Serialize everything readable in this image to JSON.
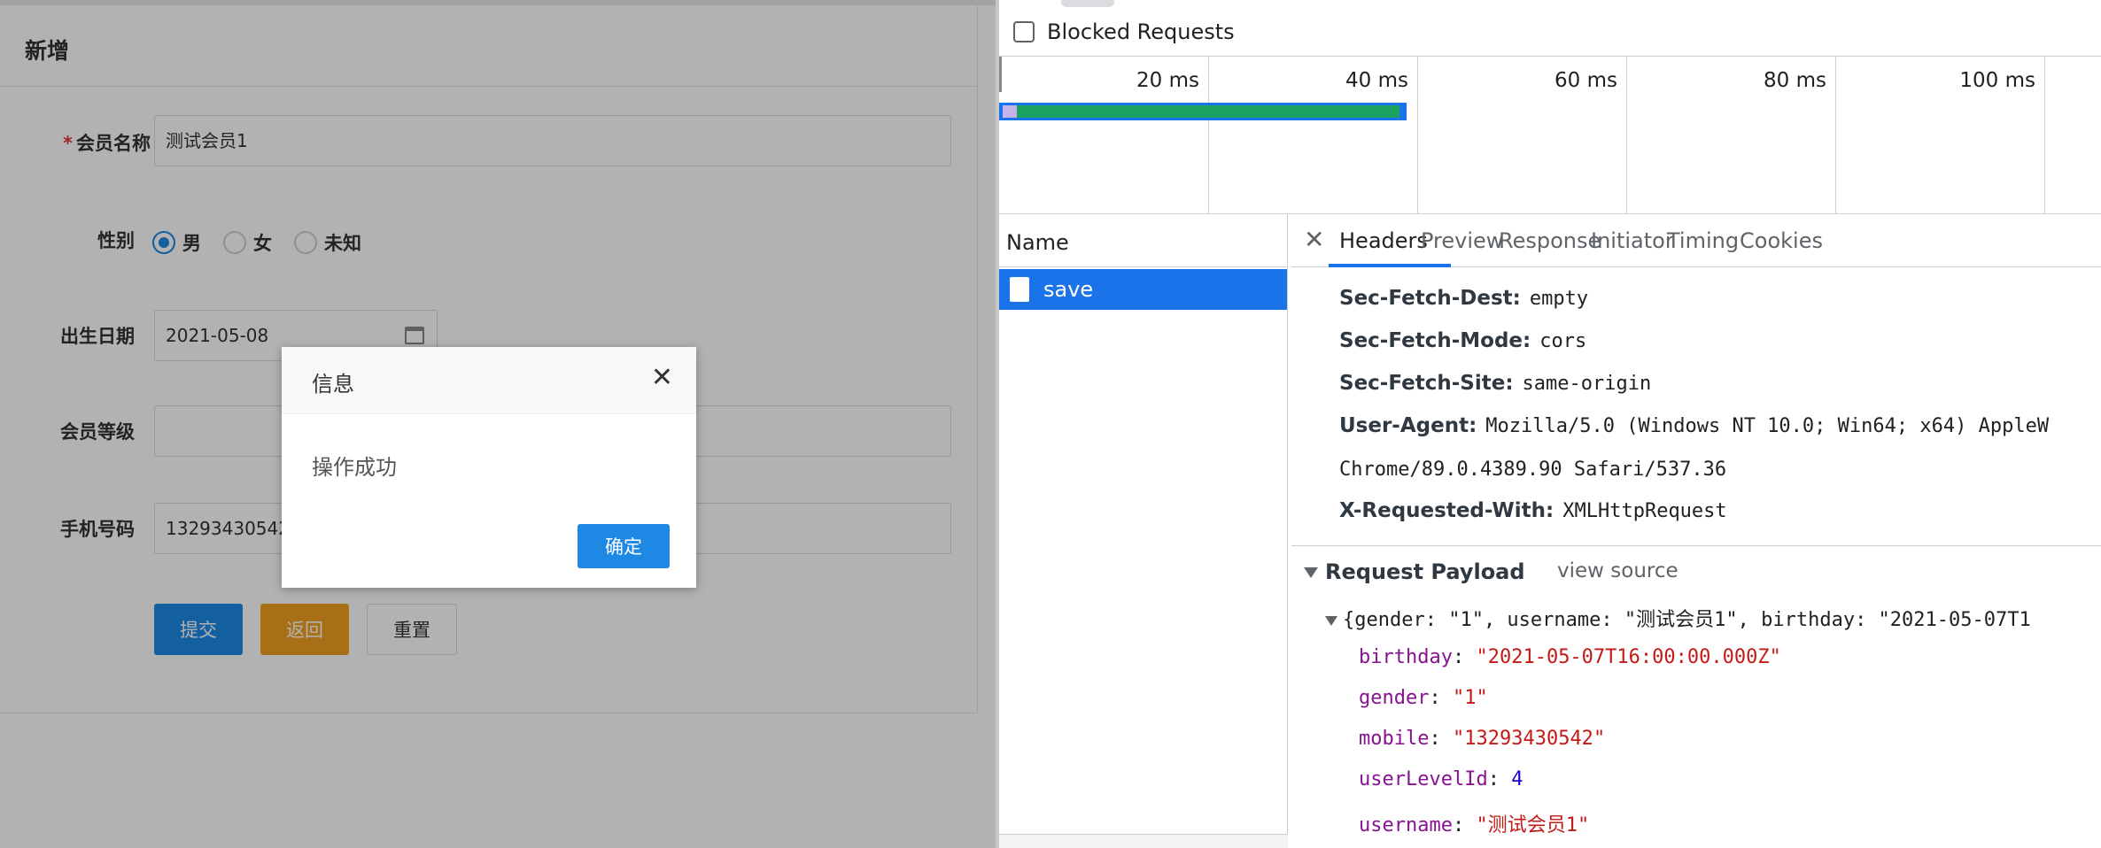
{
  "form": {
    "title": "新增",
    "fields": {
      "member_name": {
        "label": "会员名称",
        "value": "测试会员1"
      },
      "gender": {
        "label": "性别",
        "options": [
          "男",
          "女",
          "未知"
        ],
        "selected": "男"
      },
      "birthday": {
        "label": "出生日期",
        "value": "2021-05-08"
      },
      "member_level": {
        "label": "会员等级",
        "value": ""
      },
      "mobile": {
        "label": "手机号码",
        "value": "13293430542"
      }
    },
    "buttons": {
      "submit": "提交",
      "back": "返回",
      "reset": "重置"
    }
  },
  "dialog": {
    "title": "信息",
    "close": "✕",
    "message": "操作成功",
    "ok": "确定"
  },
  "devtools": {
    "blocked_requests_label": "Blocked Requests",
    "timeline_ticks": [
      "20 ms",
      "40 ms",
      "60 ms",
      "80 ms",
      "100 ms"
    ],
    "name_header": "Name",
    "request_name": "save",
    "tabs": [
      "Headers",
      "Preview",
      "Response",
      "Initiator",
      "Timing",
      "Cookies"
    ],
    "active_tab": "Headers",
    "tab_close": "✕",
    "headers": [
      {
        "key": "Sec-Fetch-Dest:",
        "value": "empty"
      },
      {
        "key": "Sec-Fetch-Mode:",
        "value": "cors"
      },
      {
        "key": "Sec-Fetch-Site:",
        "value": "same-origin"
      },
      {
        "key": "User-Agent:",
        "value": "Mozilla/5.0 (Windows NT 10.0; Win64; x64) AppleW"
      },
      {
        "key": "",
        "value": "Chrome/89.0.4389.90 Safari/537.36"
      },
      {
        "key": "X-Requested-With:",
        "value": "XMLHttpRequest"
      }
    ],
    "payload_title": "Request Payload",
    "view_source": "view source",
    "payload_summary": "{gender: \"1\", username: \"测试会员1\", birthday: \"2021-05-07T1",
    "payload": [
      {
        "key": "birthday",
        "value": "2021-05-07T16:00:00.000Z",
        "type": "string"
      },
      {
        "key": "gender",
        "value": "1",
        "type": "string"
      },
      {
        "key": "mobile",
        "value": "13293430542",
        "type": "string"
      },
      {
        "key": "userLevelId",
        "value": "4",
        "type": "number"
      },
      {
        "key": "username",
        "value": "测试会员1",
        "type": "string"
      }
    ]
  }
}
